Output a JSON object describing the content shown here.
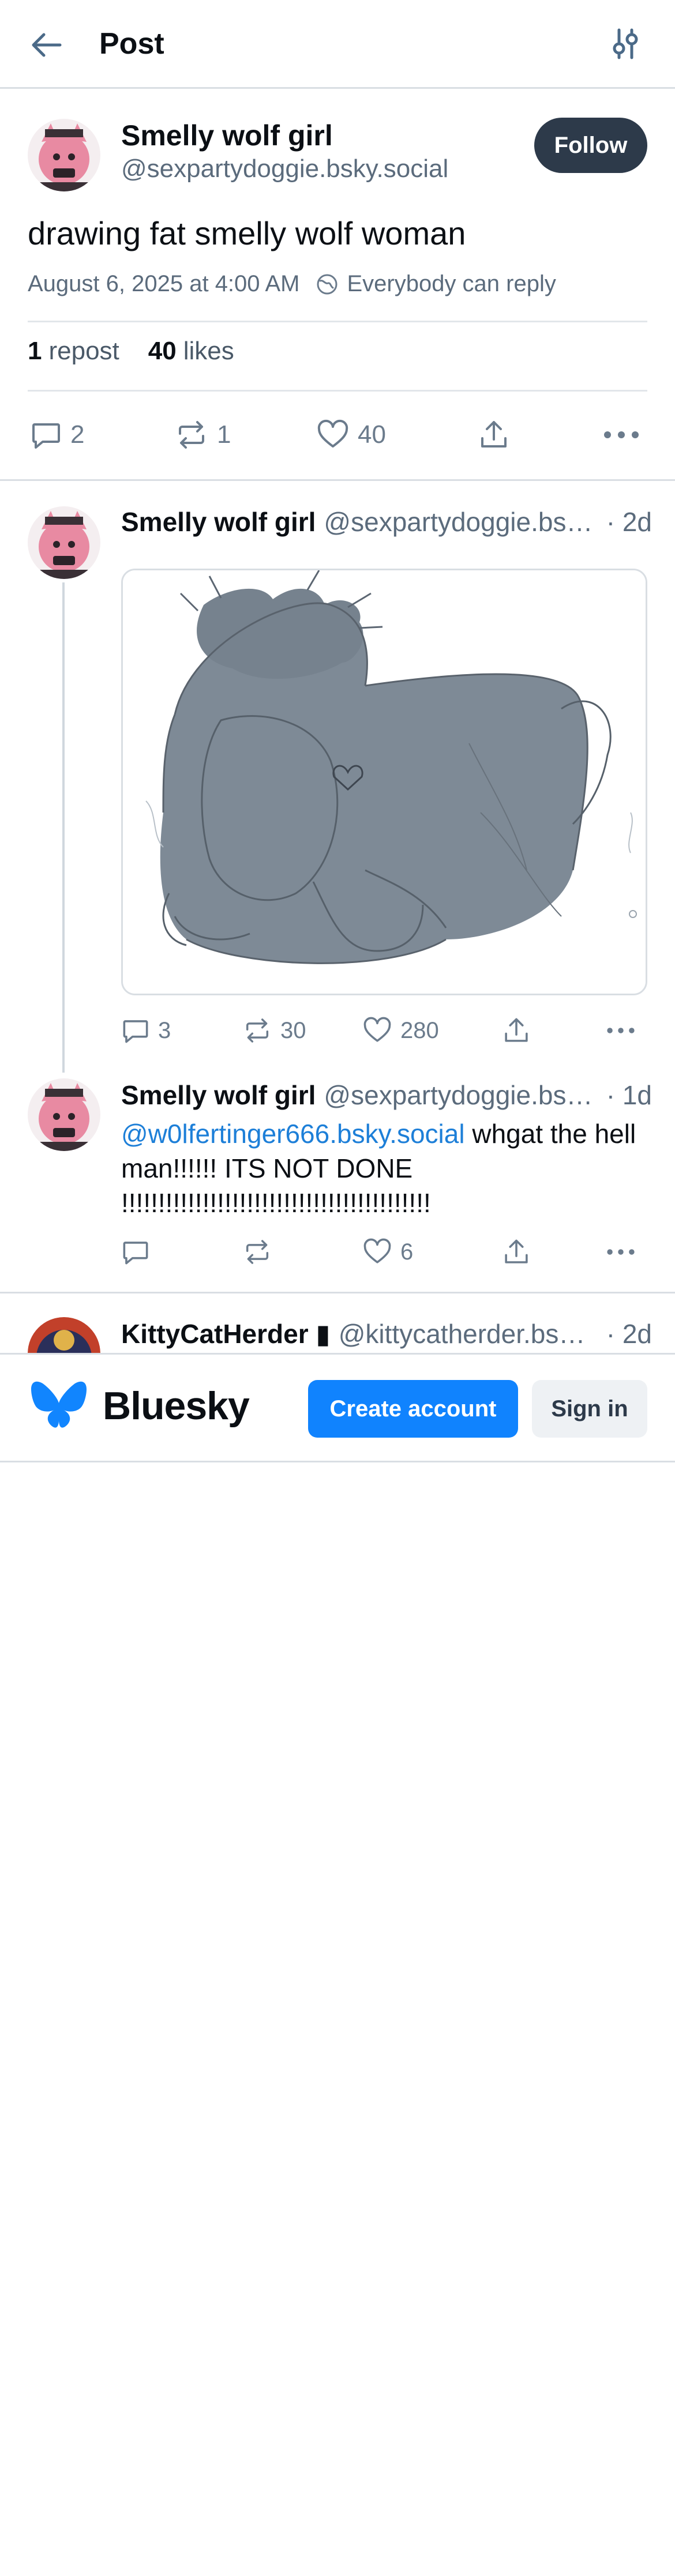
{
  "header": {
    "title": "Post",
    "back_icon": "arrow-left-icon",
    "filter_icon": "sliders-icon"
  },
  "main_post": {
    "author_name": "Smelly wolf girl",
    "author_handle": "@sexpartydoggie.bsky.social",
    "follow_label": "Follow",
    "text": "drawing fat smelly wolf woman",
    "date": "August 6, 2025 at 4:00 AM",
    "reply_setting": "Everybody can reply",
    "repost_count": "1",
    "repost_label": "repost",
    "like_count": "40",
    "like_label": "likes",
    "actions": {
      "replies": "2",
      "reposts": "1",
      "likes": "40"
    }
  },
  "replies": [
    {
      "author_name": "Smelly wolf girl",
      "author_handle": "@sexpartydoggie.bsky.social",
      "time": "· 2d",
      "replies": "3",
      "reposts": "30",
      "likes": "280"
    },
    {
      "author_name": "Smelly wolf girl",
      "author_handle": "@sexpartydoggie.bsky.social",
      "time": "· 1d",
      "mention": "@w0lfertinger666.bsky.social",
      "text": " whgat the hell man!!!!!! ITS NOT DONE !!!!!!!!!!!!!!!!!!!!!!!!!!!!!!!!!!!!!!!!!!",
      "replies": "",
      "reposts": "",
      "likes": "6"
    },
    {
      "author_name": "KittyCatHerder ▮",
      "author_handle": "@kittycatherder.bsky.social",
      "time": "· 2d"
    }
  ],
  "banner": {
    "brand": "Bluesky",
    "create_label": "Create account",
    "signin_label": "Sign in"
  },
  "colors": {
    "accent": "#1083fe",
    "follow_bg": "#2d3a4a",
    "mention": "#1d7fd8"
  }
}
